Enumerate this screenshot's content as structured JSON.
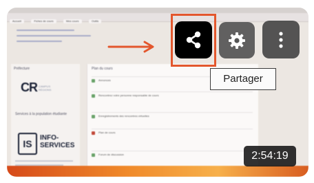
{
  "video": {
    "browser_tabs": [
      "Accueil",
      "Fiches de cours",
      "Mes cours",
      "Outils"
    ],
    "left_panel": {
      "section_label": "Préfecture",
      "logo_text": "CR",
      "logo_sub": "CAMPUS RÉGIONS",
      "services_label": "Services à la population étudiante",
      "is_logo": "IS",
      "info_services": "INFO-\nSERVICES"
    },
    "main_panel": {
      "title": "Plan du cours",
      "rows": [
        "Annonces",
        "Rencontrez votre personne responsable de cours",
        "Enregistrements des rencontres virtuelles",
        "Plan de cours",
        "Forum de discussion"
      ]
    }
  },
  "controls": {
    "share_icon": "share-icon",
    "settings_icon": "gear-icon",
    "more_icon": "more-vertical-icon"
  },
  "tooltip": {
    "text": "Partager"
  },
  "duration": {
    "text": "2:54:19"
  },
  "colors": {
    "highlight": "#e3572d",
    "arrow": "#e3572d",
    "share_button_bg": "#000000",
    "overlay_button_bg": "#555555"
  }
}
